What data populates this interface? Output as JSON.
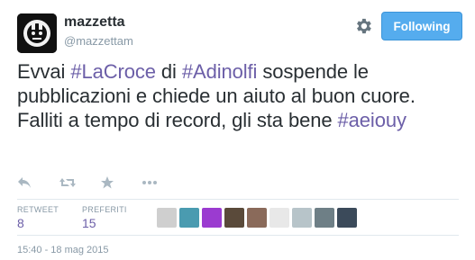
{
  "tweet": {
    "author_name": "mazzetta",
    "author_handle": "@mazzettam",
    "follow_label": "Following",
    "text_parts": [
      {
        "type": "text",
        "value": "Evvai "
      },
      {
        "type": "tag",
        "value": "#LaCroce"
      },
      {
        "type": "text",
        "value": " di "
      },
      {
        "type": "tag",
        "value": "#Adinolfi"
      },
      {
        "type": "text",
        "value": " sospende le pubblicazioni e chiede un aiuto al buon cuore. Falliti a tempo di record, gli sta bene "
      },
      {
        "type": "tag",
        "value": "#aeiouy"
      }
    ],
    "stats": {
      "retweets_label": "RETWEET",
      "retweets": "8",
      "favorites_label": "PREFERITI",
      "favorites": "15"
    },
    "timestamp": "15:40 - 18 mag 2015"
  },
  "icons": {
    "avatar": "avatar-image",
    "settings": "gear-icon",
    "reply": "reply-icon",
    "retweet": "retweet-icon",
    "favorite": "star-icon",
    "more": "more-icon"
  },
  "colors": {
    "link": "#6c5fa8",
    "follow_button": "#55acee",
    "muted": "#8899a6",
    "divider": "#e1e8ed"
  },
  "favoriters_avatars": [
    {
      "color": "#cfcfcf"
    },
    {
      "color": "#4a9bb0"
    },
    {
      "color": "#9b3bd0"
    },
    {
      "color": "#5a4a3a"
    },
    {
      "color": "#8a6a5a"
    },
    {
      "color": "#e8e8e8"
    },
    {
      "color": "#b7c4c9"
    },
    {
      "color": "#6e7f86"
    },
    {
      "color": "#3b4a5a"
    }
  ]
}
